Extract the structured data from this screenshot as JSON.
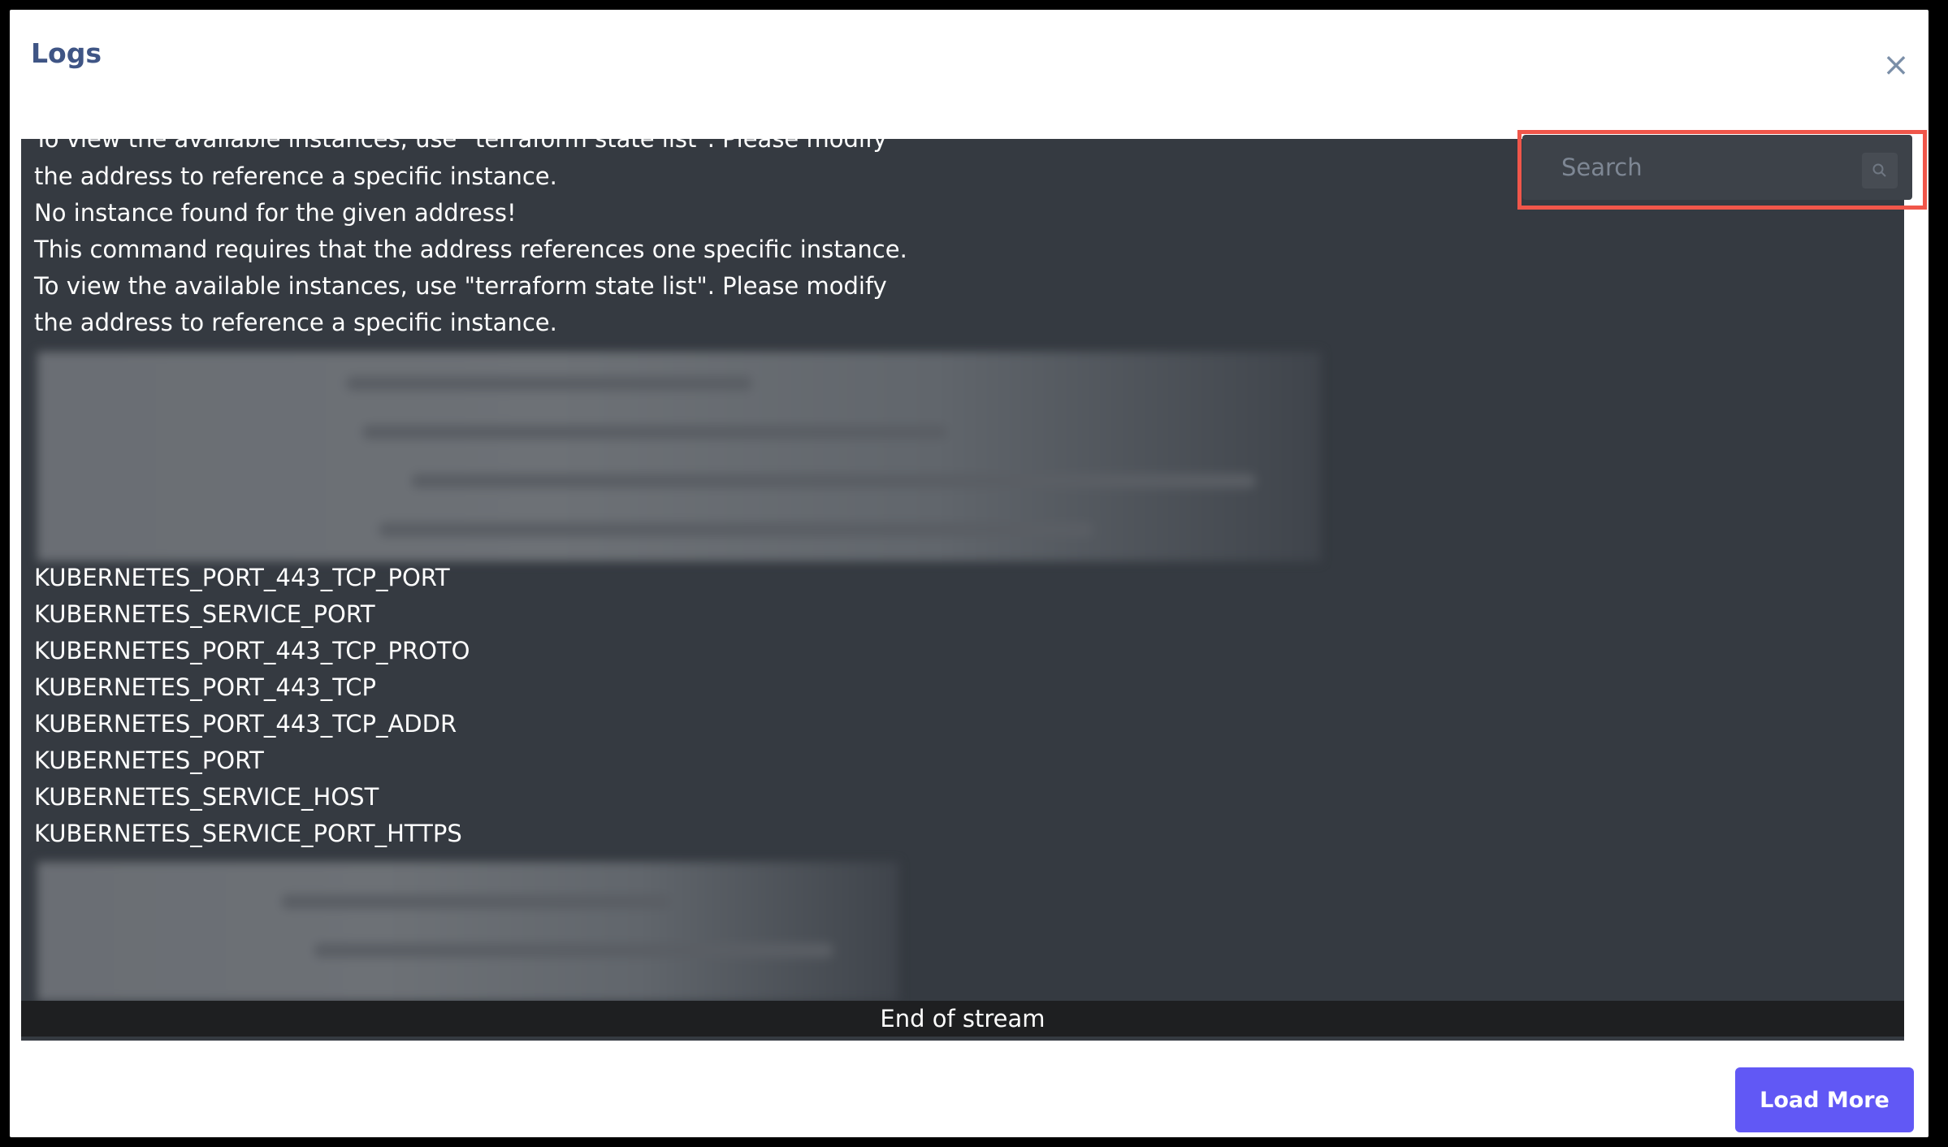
{
  "modal": {
    "title": "Logs",
    "close_glyph": "×"
  },
  "search": {
    "placeholder": "Search",
    "icon": "search-icon"
  },
  "log_lines": [
    "To view the available instances, use \"terraform state list\". Please modify",
    "the address to reference a specific instance.",
    "No instance found for the given address!",
    "This command requires that the address references one specific instance.",
    "To view the available instances, use \"terraform state list\". Please modify",
    "the address to reference a specific instance.",
    "KUBERNETES_PORT_443_TCP_PORT",
    "KUBERNETES_SERVICE_PORT",
    "KUBERNETES_PORT_443_TCP_PROTO",
    "KUBERNETES_PORT_443_TCP",
    "KUBERNETES_PORT_443_TCP_ADDR",
    "KUBERNETES_PORT",
    "KUBERNETES_SERVICE_HOST",
    "KUBERNETES_SERVICE_PORT_HTTPS"
  ],
  "stream_status": "End of stream",
  "actions": {
    "load_more_label": "Load More"
  },
  "colors": {
    "accent": "#6158f5",
    "title": "#3f5585",
    "log_background": "#353a41",
    "highlight": "#f0564a"
  }
}
